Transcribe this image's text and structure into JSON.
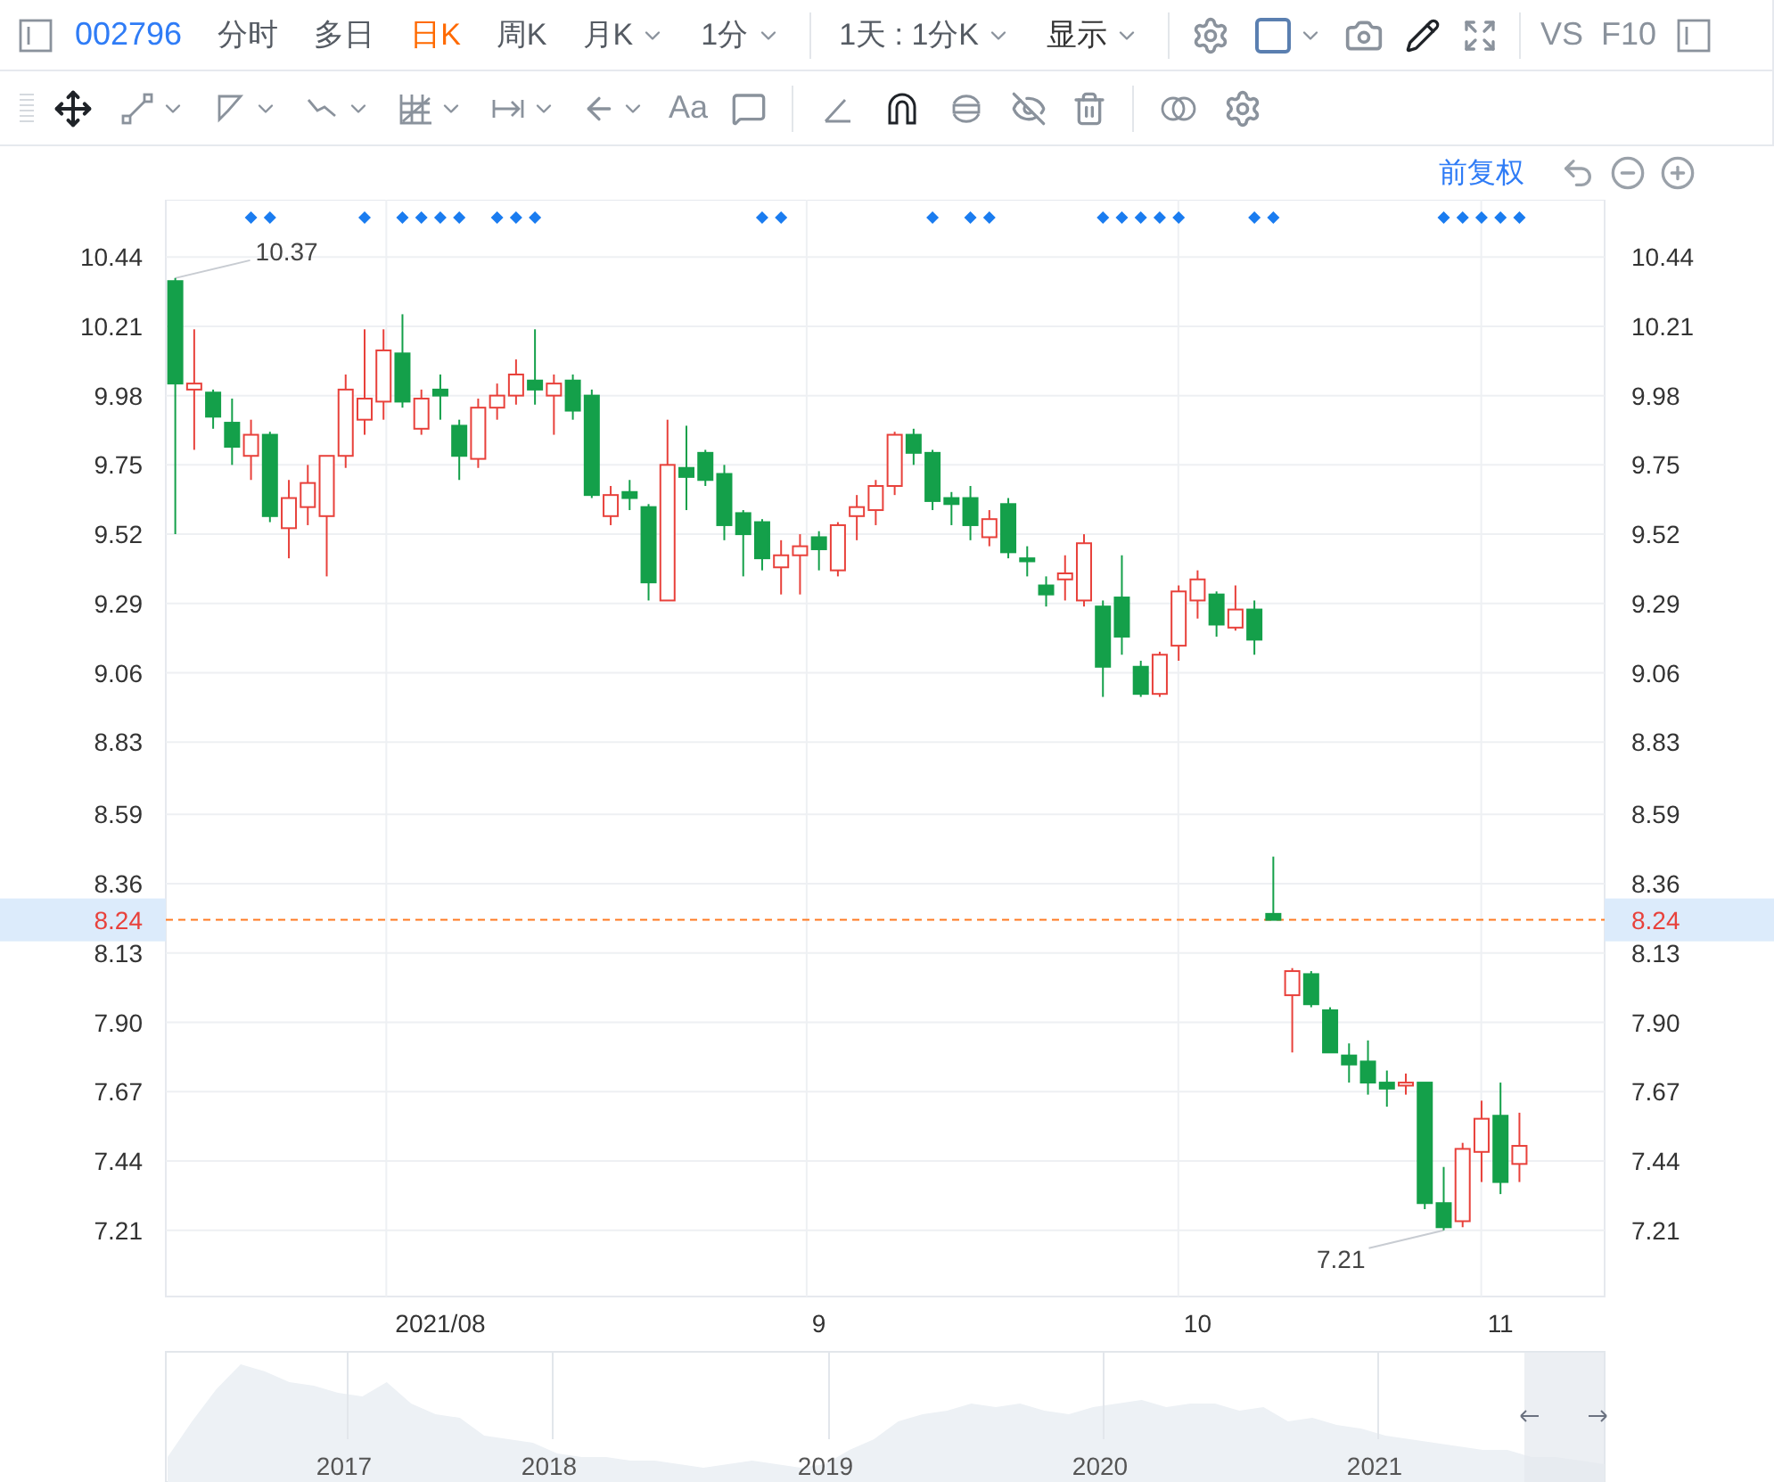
{
  "top_bar": {
    "symbol": "002796",
    "tabs": [
      {
        "label": "分时",
        "selected": false,
        "has_menu": false
      },
      {
        "label": "多日",
        "selected": false,
        "has_menu": false
      },
      {
        "label": "日K",
        "selected": true,
        "has_menu": false
      },
      {
        "label": "周K",
        "selected": false,
        "has_menu": false
      },
      {
        "label": "月K",
        "selected": false,
        "has_menu": true
      },
      {
        "label": "1分",
        "selected": false,
        "has_menu": true
      }
    ],
    "range_select": "1天 : 1分K",
    "display_menu": "显示",
    "compare": [
      "VS",
      "F10"
    ]
  },
  "drawing_toolbar": {
    "move_selected": true,
    "text_tool": "Aa",
    "magnet_on": true
  },
  "chart_header": {
    "adjust_mode": "前复权"
  },
  "event_marks": [
    false,
    false,
    false,
    false,
    true,
    true,
    false,
    false,
    false,
    false,
    true,
    false,
    true,
    true,
    true,
    true,
    false,
    true,
    true,
    true,
    false,
    false,
    false,
    false,
    false,
    false,
    false,
    false,
    false,
    false,
    false,
    true,
    true,
    false,
    false,
    false,
    false,
    false,
    false,
    false,
    true,
    false,
    true,
    true,
    false,
    false,
    false,
    false,
    false,
    true,
    true,
    true,
    true,
    true,
    false,
    false,
    false,
    true,
    true,
    false,
    false,
    false,
    false,
    false,
    false,
    false,
    false,
    true,
    true,
    true,
    true,
    true
  ],
  "current_price": {
    "right_tag": "8.24"
  },
  "chart_data": {
    "type": "candlestick",
    "categories": [
      null,
      null,
      null,
      null,
      null,
      null,
      null,
      null,
      null,
      null,
      null,
      null,
      null,
      null,
      "2021/08",
      null,
      null,
      null,
      null,
      null,
      null,
      null,
      null,
      null,
      null,
      null,
      null,
      null,
      null,
      null,
      null,
      null,
      null,
      null,
      "9",
      null,
      null,
      null,
      null,
      null,
      null,
      null,
      null,
      null,
      null,
      null,
      null,
      null,
      null,
      null,
      null,
      null,
      null,
      null,
      "10",
      null,
      null,
      null,
      null,
      null,
      null,
      null,
      null,
      null,
      null,
      null,
      null,
      null,
      null,
      null,
      "11",
      null,
      null,
      null,
      null,
      null
    ],
    "grid": true,
    "ohlc": [
      [
        10.36,
        10.37,
        9.52,
        10.02
      ],
      [
        10.0,
        10.2,
        9.8,
        10.02
      ],
      [
        9.99,
        10.0,
        9.87,
        9.91
      ],
      [
        9.89,
        9.97,
        9.75,
        9.81
      ],
      [
        9.78,
        9.9,
        9.7,
        9.85
      ],
      [
        9.85,
        9.86,
        9.56,
        9.58
      ],
      [
        9.54,
        9.7,
        9.44,
        9.64
      ],
      [
        9.61,
        9.75,
        9.55,
        9.69
      ],
      [
        9.58,
        9.78,
        9.38,
        9.78
      ],
      [
        9.78,
        10.05,
        9.74,
        10.0
      ],
      [
        9.9,
        10.2,
        9.85,
        9.97
      ],
      [
        9.96,
        10.2,
        9.9,
        10.13
      ],
      [
        10.12,
        10.25,
        9.94,
        9.96
      ],
      [
        9.87,
        10.0,
        9.85,
        9.97
      ],
      [
        10.0,
        10.05,
        9.9,
        9.98
      ],
      [
        9.88,
        9.9,
        9.7,
        9.78
      ],
      [
        9.77,
        9.97,
        9.74,
        9.94
      ],
      [
        9.94,
        10.02,
        9.9,
        9.98
      ],
      [
        9.98,
        10.1,
        9.95,
        10.05
      ],
      [
        10.03,
        10.2,
        9.95,
        10.0
      ],
      [
        9.98,
        10.05,
        9.85,
        10.02
      ],
      [
        10.03,
        10.05,
        9.9,
        9.93
      ],
      [
        9.98,
        10.0,
        9.64,
        9.65
      ],
      [
        9.58,
        9.68,
        9.55,
        9.65
      ],
      [
        9.66,
        9.7,
        9.6,
        9.64
      ],
      [
        9.61,
        9.62,
        9.3,
        9.36
      ],
      [
        9.3,
        9.9,
        9.3,
        9.75
      ],
      [
        9.74,
        9.88,
        9.6,
        9.71
      ],
      [
        9.79,
        9.8,
        9.68,
        9.7
      ],
      [
        9.72,
        9.75,
        9.5,
        9.55
      ],
      [
        9.59,
        9.6,
        9.38,
        9.52
      ],
      [
        9.56,
        9.57,
        9.4,
        9.44
      ],
      [
        9.41,
        9.5,
        9.32,
        9.45
      ],
      [
        9.45,
        9.52,
        9.32,
        9.48
      ],
      [
        9.51,
        9.53,
        9.4,
        9.47
      ],
      [
        9.4,
        9.56,
        9.38,
        9.55
      ],
      [
        9.58,
        9.65,
        9.5,
        9.61
      ],
      [
        9.6,
        9.7,
        9.55,
        9.68
      ],
      [
        9.68,
        9.86,
        9.65,
        9.85
      ],
      [
        9.85,
        9.87,
        9.75,
        9.79
      ],
      [
        9.79,
        9.8,
        9.6,
        9.63
      ],
      [
        9.64,
        9.66,
        9.55,
        9.62
      ],
      [
        9.64,
        9.68,
        9.5,
        9.55
      ],
      [
        9.51,
        9.6,
        9.48,
        9.57
      ],
      [
        9.62,
        9.64,
        9.44,
        9.46
      ],
      [
        9.44,
        9.48,
        9.38,
        9.43
      ],
      [
        9.35,
        9.38,
        9.28,
        9.32
      ],
      [
        9.37,
        9.45,
        9.3,
        9.39
      ],
      [
        9.3,
        9.52,
        9.28,
        9.49
      ],
      [
        9.28,
        9.3,
        8.98,
        9.08
      ],
      [
        9.31,
        9.45,
        9.12,
        9.18
      ],
      [
        9.08,
        9.1,
        8.98,
        8.99
      ],
      [
        8.99,
        9.13,
        8.98,
        9.12
      ],
      [
        9.15,
        9.35,
        9.1,
        9.33
      ],
      [
        9.3,
        9.4,
        9.24,
        9.37
      ],
      [
        9.32,
        9.33,
        9.18,
        9.22
      ],
      [
        9.21,
        9.35,
        9.2,
        9.27
      ],
      [
        9.27,
        9.3,
        9.12,
        9.17
      ],
      [
        8.26,
        8.45,
        8.24,
        8.24
      ],
      [
        7.99,
        8.08,
        7.8,
        8.07
      ],
      [
        8.06,
        8.07,
        7.95,
        7.96
      ],
      [
        7.94,
        7.95,
        7.8,
        7.8
      ],
      [
        7.79,
        7.83,
        7.7,
        7.76
      ],
      [
        7.77,
        7.84,
        7.66,
        7.7
      ],
      [
        7.7,
        7.74,
        7.62,
        7.68
      ],
      [
        7.69,
        7.73,
        7.66,
        7.7
      ],
      [
        7.7,
        7.7,
        7.28,
        7.3
      ],
      [
        7.3,
        7.42,
        7.21,
        7.22
      ],
      [
        7.24,
        7.5,
        7.22,
        7.48
      ],
      [
        7.47,
        7.64,
        7.37,
        7.58
      ],
      [
        7.59,
        7.7,
        7.33,
        7.37
      ],
      [
        7.43,
        7.6,
        7.37,
        7.49
      ],
      null,
      null,
      null,
      null
    ],
    "ylim": [
      6.99,
      10.63
    ],
    "yticks": [
      {
        "value": 10.44,
        "label": "10.44"
      },
      {
        "value": 10.21,
        "label": "10.21"
      },
      {
        "value": 9.98,
        "label": "9.98"
      },
      {
        "value": 9.75,
        "label": "9.75"
      },
      {
        "value": 9.52,
        "label": "9.52"
      },
      {
        "value": 9.29,
        "label": "9.29"
      },
      {
        "value": 9.06,
        "label": "9.06"
      },
      {
        "value": 8.83,
        "label": "8.83"
      },
      {
        "value": 8.59,
        "label": "8.59"
      },
      {
        "value": 8.36,
        "label": "8.36"
      },
      {
        "value": 8.13,
        "label": "8.13"
      },
      {
        "value": 7.9,
        "label": "7.90"
      },
      {
        "value": 7.67,
        "label": "7.67"
      },
      {
        "value": 7.44,
        "label": "7.44"
      },
      {
        "value": 7.21,
        "label": "7.21"
      }
    ],
    "ref_lines": [
      {
        "axis": "y",
        "value": 8.24,
        "label": "8.24"
      }
    ],
    "annotations": [
      "10.37",
      "7.21"
    ]
  },
  "navigator": {
    "years": [
      "2017",
      "2018",
      "2019",
      "2020",
      "2021"
    ]
  }
}
